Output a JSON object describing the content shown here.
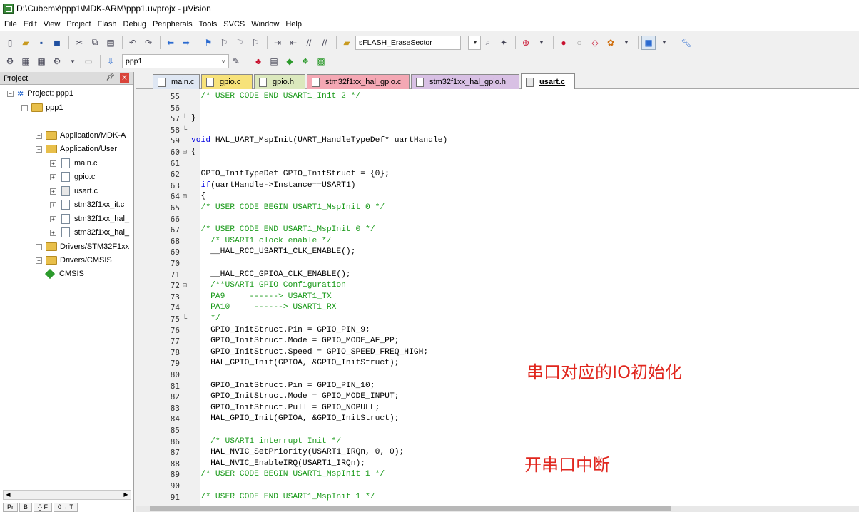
{
  "window": {
    "title": "D:\\Cubemx\\ppp1\\MDK-ARM\\ppp1.uvprojx - µVision"
  },
  "menu": [
    "File",
    "Edit",
    "View",
    "Project",
    "Flash",
    "Debug",
    "Peripherals",
    "Tools",
    "SVCS",
    "Window",
    "Help"
  ],
  "toolbar": {
    "function_combo": "sFLASH_EraseSector",
    "target_combo": "ppp1"
  },
  "project_panel": {
    "title": "Project",
    "pin": "X",
    "root": "Project: ppp1",
    "target": "ppp1",
    "groups": [
      "Application/MDK-A",
      "Application/User",
      "Drivers/STM32F1xx",
      "Drivers/CMSIS"
    ],
    "files": [
      "main.c",
      "gpio.c",
      "usart.c",
      "stm32f1xx_it.c",
      "stm32f1xx_hal_",
      "stm32f1xx_hal_"
    ],
    "cmsis": "CMSIS",
    "bottom_tabs": [
      "Pr",
      "B",
      "{} F",
      "0→ T"
    ]
  },
  "tabs": [
    "main.c",
    "gpio.c",
    "gpio.h",
    "stm32f1xx_hal_gpio.c",
    "stm32f1xx_hal_gpio.h",
    "usart.c"
  ],
  "active_tab": "usart.c",
  "code_lines": [
    {
      "n": "55",
      "t": "  /* USER CODE END USART1_Init 2 */"
    },
    {
      "n": "56",
      "t": ""
    },
    {
      "n": "57",
      "t": "}"
    },
    {
      "n": "58",
      "t": ""
    },
    {
      "n": "59",
      "t": "void HAL_UART_MspInit(UART_HandleTypeDef* uartHandle)"
    },
    {
      "n": "60",
      "t": "{"
    },
    {
      "n": "61",
      "t": ""
    },
    {
      "n": "62",
      "t": "  GPIO_InitTypeDef GPIO_InitStruct = {0};"
    },
    {
      "n": "63",
      "t": "  if(uartHandle->Instance==USART1)"
    },
    {
      "n": "64",
      "t": "  {"
    },
    {
      "n": "65",
      "t": "  /* USER CODE BEGIN USART1_MspInit 0 */"
    },
    {
      "n": "66",
      "t": ""
    },
    {
      "n": "67",
      "t": "  /* USER CODE END USART1_MspInit 0 */"
    },
    {
      "n": "68",
      "t": "    /* USART1 clock enable */"
    },
    {
      "n": "69",
      "t": "    __HAL_RCC_USART1_CLK_ENABLE();"
    },
    {
      "n": "70",
      "t": ""
    },
    {
      "n": "71",
      "t": "    __HAL_RCC_GPIOA_CLK_ENABLE();"
    },
    {
      "n": "72",
      "t": "    /**USART1 GPIO Configuration"
    },
    {
      "n": "73",
      "t": "    PA9     ------> USART1_TX"
    },
    {
      "n": "74",
      "t": "    PA10     ------> USART1_RX"
    },
    {
      "n": "75",
      "t": "    */"
    },
    {
      "n": "76",
      "t": "    GPIO_InitStruct.Pin = GPIO_PIN_9;"
    },
    {
      "n": "77",
      "t": "    GPIO_InitStruct.Mode = GPIO_MODE_AF_PP;"
    },
    {
      "n": "78",
      "t": "    GPIO_InitStruct.Speed = GPIO_SPEED_FREQ_HIGH;"
    },
    {
      "n": "79",
      "t": "    HAL_GPIO_Init(GPIOA, &GPIO_InitStruct);"
    },
    {
      "n": "80",
      "t": ""
    },
    {
      "n": "81",
      "t": "    GPIO_InitStruct.Pin = GPIO_PIN_10;"
    },
    {
      "n": "82",
      "t": "    GPIO_InitStruct.Mode = GPIO_MODE_INPUT;"
    },
    {
      "n": "83",
      "t": "    GPIO_InitStruct.Pull = GPIO_NOPULL;"
    },
    {
      "n": "84",
      "t": "    HAL_GPIO_Init(GPIOA, &GPIO_InitStruct);"
    },
    {
      "n": "85",
      "t": ""
    },
    {
      "n": "86",
      "t": "    /* USART1 interrupt Init */"
    },
    {
      "n": "87",
      "t": "    HAL_NVIC_SetPriority(USART1_IRQn, 0, 0);"
    },
    {
      "n": "88",
      "t": "    HAL_NVIC_EnableIRQ(USART1_IRQn);"
    },
    {
      "n": "89",
      "t": "  /* USER CODE BEGIN USART1_MspInit 1 */"
    },
    {
      "n": "90",
      "t": ""
    },
    {
      "n": "91",
      "t": "  /* USER CODE END USART1_MspInit 1 */"
    }
  ],
  "annotations": [
    "串口对应的IO初始化",
    "开串口中断"
  ],
  "colors": {
    "comment": "#1a9a1a",
    "keyword": "#0000e0",
    "annotation": "#e0261d"
  }
}
